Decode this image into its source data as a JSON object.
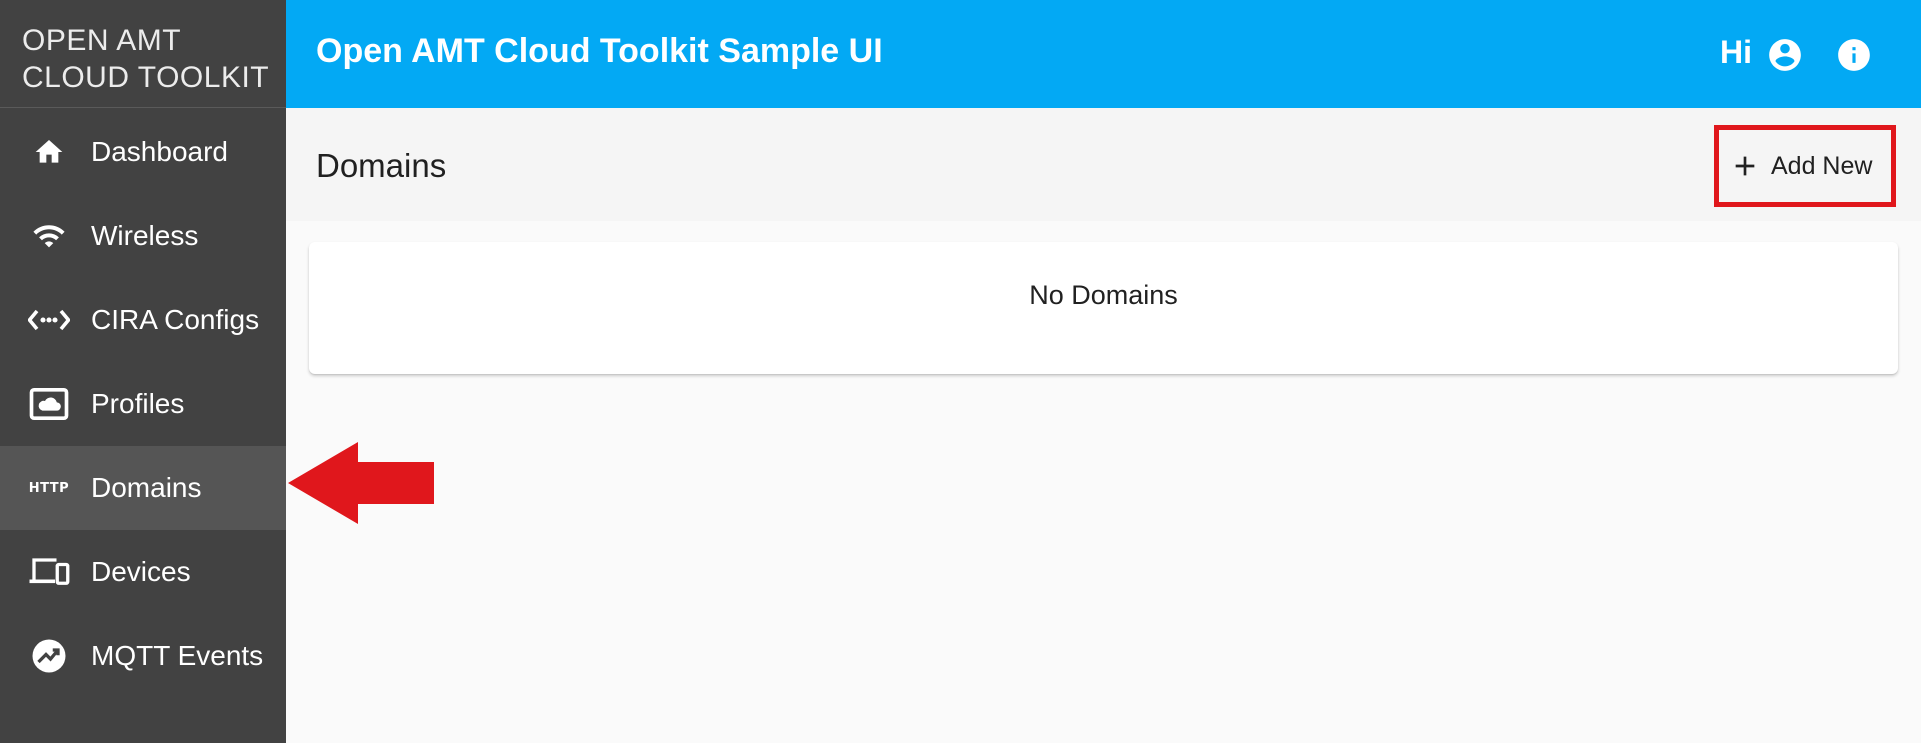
{
  "brand": {
    "line1": "OPEN AMT",
    "line2": "CLOUD TOOLKIT"
  },
  "sidebar": {
    "items": [
      {
        "label": "Dashboard",
        "icon": "home-icon"
      },
      {
        "label": "Wireless",
        "icon": "wifi-icon"
      },
      {
        "label": "CIRA Configs",
        "icon": "code-dots-icon"
      },
      {
        "label": "Profiles",
        "icon": "cloud-box-icon"
      },
      {
        "label": "Domains",
        "icon": "http-icon",
        "icon_text": "HTTP",
        "active": true
      },
      {
        "label": "Devices",
        "icon": "devices-icon"
      },
      {
        "label": "MQTT Events",
        "icon": "chart-trend-icon"
      }
    ]
  },
  "header": {
    "title": "Open AMT Cloud Toolkit Sample UI",
    "greeting": "Hi",
    "user_icon": "account-circle-icon",
    "info_icon": "info-icon"
  },
  "toolbar": {
    "title": "Domains",
    "add_label": "Add New",
    "add_icon": "plus-icon"
  },
  "content": {
    "empty_message": "No Domains"
  },
  "colors": {
    "sidebar_bg": "#424242",
    "sidebar_active_bg": "#555555",
    "header_bg": "#03a9f4",
    "toolbar_bg": "#f5f5f5",
    "annotation_red": "#e0171c"
  }
}
